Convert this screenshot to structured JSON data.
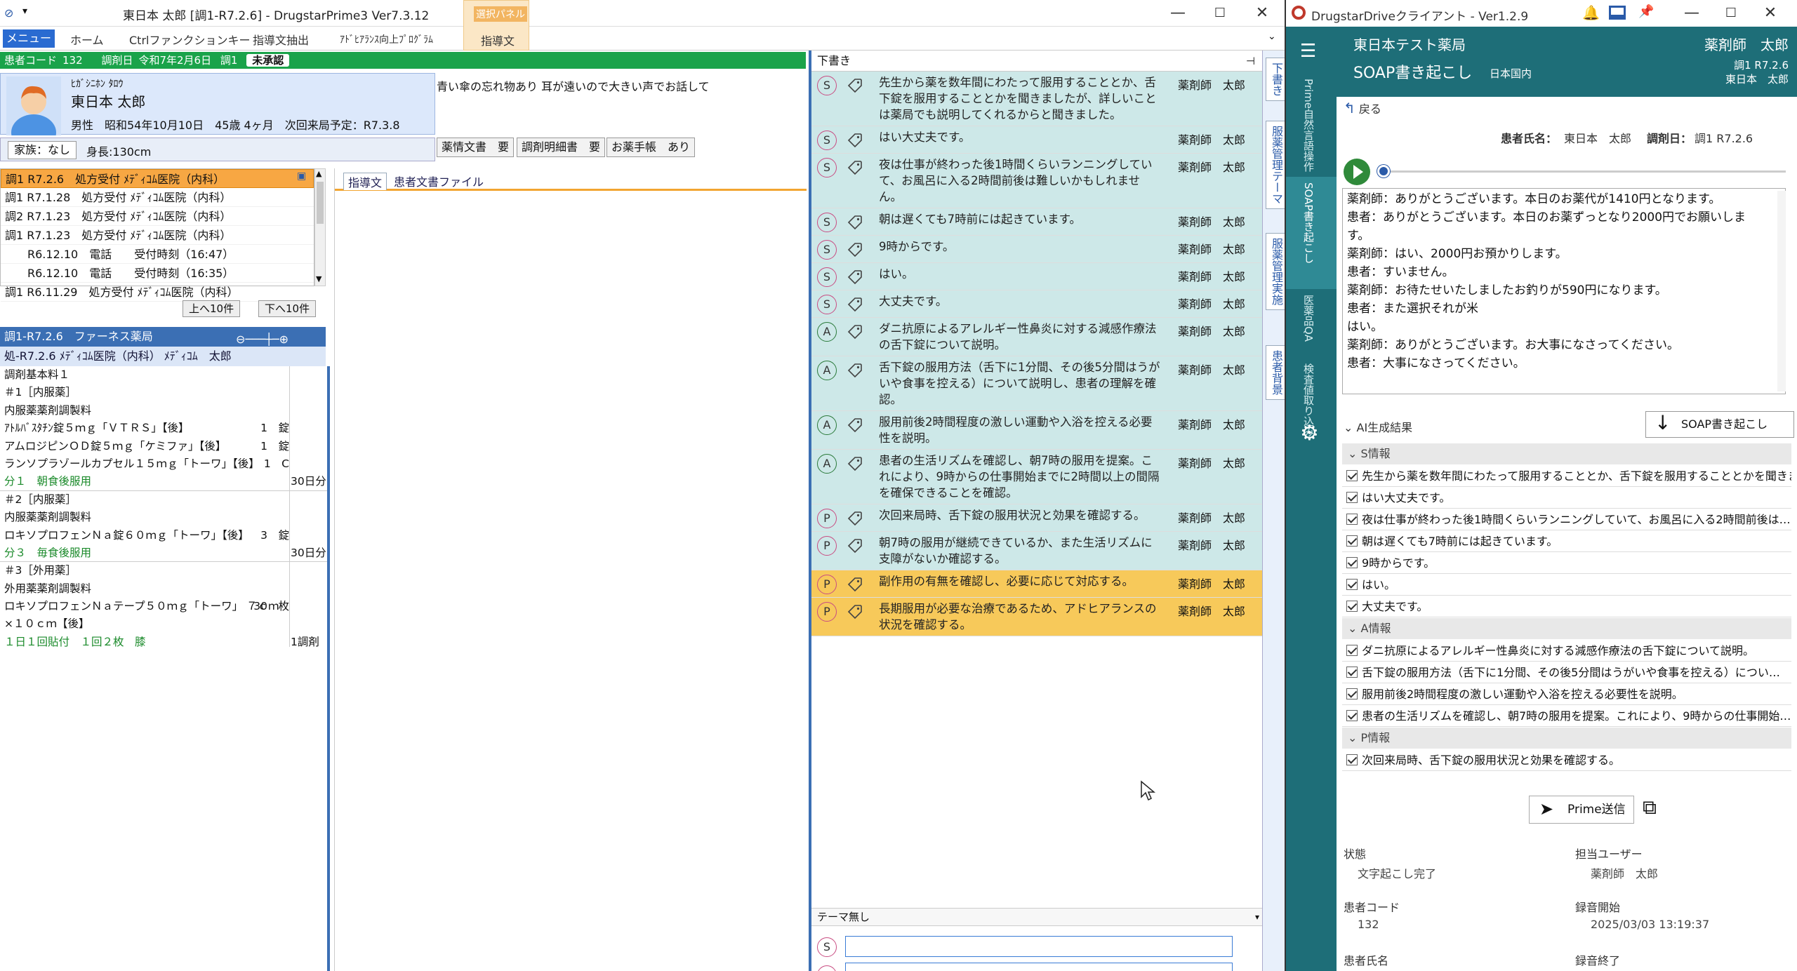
{
  "left": {
    "title": "東日本 太郎 [調1-R7.2.6] - DrugstarPrime3 Ver7.3.12",
    "ribbon": {
      "menu": "メニュー",
      "tabs": [
        "ホーム",
        "Ctrlファンクションキー",
        "指導文抽出",
        "ｱﾄﾞﾋｱﾗﾝｽ向上ﾌﾟﾛｸﾞﾗﾑ"
      ],
      "sel_panel_label": "選択パネル",
      "sel_panel_tab": "指導文"
    },
    "status_bar": {
      "code_label": "患者コード",
      "code": "132",
      "date_label": "調剤日",
      "date": "令和7年2月6日",
      "dispense": "調1",
      "approval": "未承認"
    },
    "patient": {
      "kana": "ﾋｶﾞｼﾆﾎﾝ ﾀﾛｳ",
      "name": "東日本 太郎",
      "info": "男性　昭和54年10月10日　45歳 4ヶ月　次回来局予定：R7.3.8",
      "family": "家族：なし",
      "height": "身長:130cm",
      "memo": "青い傘の忘れ物あり 耳が遠いので大きい声でお話して",
      "doc_buttons": [
        "薬情文書　要",
        "調剤明細書　要",
        "お薬手帳　あり"
      ]
    },
    "history": [
      "調1 R7.2.6　処方受付 ﾒﾃﾞｨｺﾑ医院（内科）",
      "調1 R7.1.28　処方受付 ﾒﾃﾞｨｺﾑ医院（内科）",
      "調2 R7.1.23　処方受付 ﾒﾃﾞｨｺﾑ医院（内科）",
      "調1 R7.1.23　処方受付 ﾒﾃﾞｨｺﾑ医院（内科）",
      "　　R6.12.10　電話　　受付時刻（16:47）",
      "　　R6.12.10　電話　　受付時刻（16:35）",
      "調1 R6.11.29　処方受付 ﾒﾃﾞｨｺﾑ医院（内科）"
    ],
    "page_buttons": [
      "上へ10件",
      "下へ10件"
    ],
    "rx_header": "調1-R7.2.6　ファーネス薬局",
    "rx_sub": "処-R7.2.6 ﾒﾃﾞｨｺﾑ医院（内科） ﾒﾃﾞｨｺﾑ　太郎",
    "rx_rows": [
      {
        "t": "調剤基本料１",
        "r": "",
        "d": ""
      },
      {
        "t": "＃1［内服薬］",
        "r": "",
        "d": ""
      },
      {
        "t": "内服薬薬剤調製料",
        "r": "",
        "d": ""
      },
      {
        "t": "ｱﾄﾙﾊﾞｽﾀﾁﾝ錠５ｍｇ「ＶＴＲＳ」【後】",
        "r": "1　錠",
        "d": ""
      },
      {
        "t": "アムロジピンＯＤ錠５ｍｇ「ケミファ」【後】",
        "r": "1　錠",
        "d": ""
      },
      {
        "t": "ランソプラゾールカプセル１５ｍｇ「トーワ」【後】",
        "r": "1　C",
        "d": ""
      },
      {
        "t": "分１　朝食後服用",
        "r": "",
        "d": "30日分",
        "g": true
      },
      {
        "t": "＃2［内服薬］",
        "r": "",
        "d": ""
      },
      {
        "t": "内服薬薬剤調製料",
        "r": "",
        "d": ""
      },
      {
        "t": "ロキソプロフェンＮａ錠６０ｍｇ「トーワ」【後】",
        "r": "3　錠",
        "d": ""
      },
      {
        "t": "分３　毎食後服用",
        "r": "",
        "d": "30日分",
        "g": true
      },
      {
        "t": "＃3［外用薬］",
        "r": "",
        "d": ""
      },
      {
        "t": "外用薬薬剤調製料",
        "r": "",
        "d": ""
      },
      {
        "t": "ロキソプロフェンＮａテープ５０ｍｇ「トーワ」 ７ｃｍ",
        "r": "30　枚",
        "d": ""
      },
      {
        "t": "×１０ｃｍ【後】",
        "r": "",
        "d": ""
      },
      {
        "t": "１日１回貼付　１回２枚　膝",
        "r": "",
        "d": "1調剤",
        "g": true
      }
    ],
    "guide_tabs": [
      "指導文",
      "患者文書ファイル"
    ]
  },
  "draft": {
    "header": "下書き",
    "rows": [
      {
        "tag": "S",
        "text": "先生から薬を数年間にわたって服用することとか、舌下錠を服用することとかを聞きましたが、詳しいことは薬局でも説明してくれるからと聞きました。",
        "who": "薬剤師　太郎",
        "y": false
      },
      {
        "tag": "S",
        "text": "はい大丈夫です。",
        "who": "薬剤師　太郎",
        "y": false
      },
      {
        "tag": "S",
        "text": "夜は仕事が終わった後1時間くらいランニングしていて、お風呂に入る2時間前後は難しいかもしれません。",
        "who": "薬剤師　太郎",
        "y": false
      },
      {
        "tag": "S",
        "text": "朝は遅くても7時前には起きています。",
        "who": "薬剤師　太郎",
        "y": false
      },
      {
        "tag": "S",
        "text": "9時からです。",
        "who": "薬剤師　太郎",
        "y": false
      },
      {
        "tag": "S",
        "text": "はい。",
        "who": "薬剤師　太郎",
        "y": false
      },
      {
        "tag": "S",
        "text": "大丈夫です。",
        "who": "薬剤師　太郎",
        "y": false
      },
      {
        "tag": "A",
        "text": "ダニ抗原によるアレルギー性鼻炎に対する減感作療法の舌下錠について説明。",
        "who": "薬剤師　太郎",
        "y": false
      },
      {
        "tag": "A",
        "text": "舌下錠の服用方法（舌下に1分間、その後5分間はうがいや食事を控える）について説明し、患者の理解を確認。",
        "who": "薬剤師　太郎",
        "y": false
      },
      {
        "tag": "A",
        "text": "服用前後2時間程度の激しい運動や入浴を控える必要性を説明。",
        "who": "薬剤師　太郎",
        "y": false
      },
      {
        "tag": "A",
        "text": "患者の生活リズムを確認し、朝7時の服用を提案。これにより、9時からの仕事開始までに2時間以上の間隔を確保できることを確認。",
        "who": "薬剤師　太郎",
        "y": false
      },
      {
        "tag": "P",
        "text": "次回来局時、舌下錠の服用状況と効果を確認する。",
        "who": "薬剤師　太郎",
        "y": false
      },
      {
        "tag": "P",
        "text": "朝7時の服用が継続できているか、また生活リズムに支障がないか確認する。",
        "who": "薬剤師　太郎",
        "y": false
      },
      {
        "tag": "P",
        "text": "副作用の有無を確認し、必要に応じて対応する。",
        "who": "薬剤師　太郎",
        "y": true
      },
      {
        "tag": "P",
        "text": "長期服用が必要な治療であるため、アドヒアランスの状況を確認する。",
        "who": "薬剤師　太郎",
        "y": true
      }
    ],
    "footer": "テーマ無し",
    "input_tag": "S",
    "side_tabs": [
      "下書き",
      "服薬管理テーマ",
      "服薬管理実施",
      "患者背景"
    ]
  },
  "right": {
    "title": "DrugstarDriveクライアント - Ver1.2.9",
    "nav": [
      "Prime自然言語操作",
      "SOAP書き起こし",
      "医薬品QA",
      "検査値取り込み"
    ],
    "pharmacy": "東日本テスト薬局",
    "user": "薬剤師　太郎",
    "page_title": "SOAP書き起こし",
    "region": "日本国内",
    "disp": "調1 R7.2.6",
    "disp_patient": "東日本　太郎",
    "back": "戻る",
    "patient_label": "患者氏名：",
    "patient_name": "東日本　太郎",
    "disp_label": "調剤日：",
    "disp_date": "調1 R7.2.6",
    "transcript": [
      "薬剤師：ありがとうございます。本日のお薬代が1410円となります。",
      "患者：ありがとうございます。本日のお薬ずっとなり2000円でお願いしま",
      "す。",
      "薬剤師：はい、2000円お預かりします。",
      "患者：すいません。",
      "薬剤師：お待たせいたしましたお釣りが590円になります。",
      "患者：また選択それが米",
      "はい。",
      "薬剤師：ありがとうございます。お大事になさってください。",
      "患者：大事になさってください。"
    ],
    "ai_label": "AI生成結果",
    "soap_btn": "SOAP書き起こし",
    "s_label": "S情報",
    "s_items": [
      "先生から薬を数年間にわたって服用することとか、舌下錠を服用することとかを聞きま…",
      "はい大丈夫です。",
      "夜は仕事が終わった後1時間くらいランニングしていて、お風呂に入る2時間前後は…",
      "朝は遅くても7時前には起きています。",
      "9時からです。",
      "はい。",
      "大丈夫です。"
    ],
    "a_label": "A情報",
    "a_items": [
      "ダニ抗原によるアレルギー性鼻炎に対する減感作療法の舌下錠について説明。",
      "舌下錠の服用方法（舌下に1分間、その後5分間はうがいや食事を控える）につい…",
      "服用前後2時間程度の激しい運動や入浴を控える必要性を説明。",
      "患者の生活リズムを確認し、朝7時の服用を提案。これにより、9時からの仕事開始…"
    ],
    "p_label": "P情報",
    "p_items": [
      "次回来局時、舌下錠の服用状況と効果を確認する。"
    ],
    "send_btn": "Prime送信",
    "info": {
      "status_l": "状態",
      "status_v": "文字起こし完了",
      "user_l": "担当ユーザー",
      "user_v": "薬剤師　太郎",
      "code_l": "患者コード",
      "code_v": "132",
      "rec_l": "録音開始",
      "rec_v": "2025/03/03 13:19:37",
      "name_l": "患者氏名",
      "end_l": "録音終了"
    }
  }
}
